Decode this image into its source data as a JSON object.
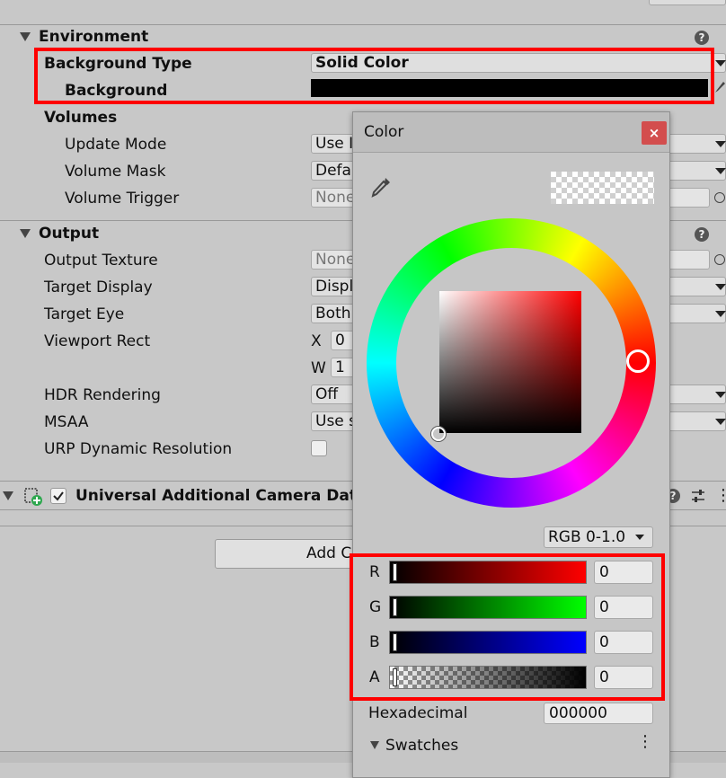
{
  "environment": {
    "header": "Environment",
    "background_type_label": "Background Type",
    "background_type_value": "Solid Color",
    "background_label": "Background",
    "background_color": "#000000"
  },
  "volumes": {
    "header": "Volumes",
    "update_mode_label": "Update Mode",
    "update_mode_value": "Use I",
    "volume_mask_label": "Volume Mask",
    "volume_mask_value": "Defau",
    "volume_trigger_label": "Volume Trigger",
    "volume_trigger_value": "None"
  },
  "output": {
    "header": "Output",
    "output_texture_label": "Output Texture",
    "output_texture_value": "None",
    "target_display_label": "Target Display",
    "target_display_value": "Displ",
    "target_eye_label": "Target Eye",
    "target_eye_value": "Both",
    "viewport_rect_label": "Viewport Rect",
    "viewport_x_label": "X",
    "viewport_x_value": "0",
    "viewport_w_label": "W",
    "viewport_w_value": "1",
    "hdr_label": "HDR Rendering",
    "hdr_value": "Off",
    "msaa_label": "MSAA",
    "msaa_value": "Use s",
    "urp_dynres_label": "URP Dynamic Resolution"
  },
  "component": {
    "name": "Universal Additional Camera Data (S"
  },
  "add_component_label": "Add C",
  "help_glyph": "?",
  "color_window": {
    "title": "Color",
    "close_glyph": "×",
    "mode_value": "RGB 0-1.0",
    "channels": [
      {
        "label": "R",
        "value": "0"
      },
      {
        "label": "G",
        "value": "0"
      },
      {
        "label": "B",
        "value": "0"
      },
      {
        "label": "A",
        "value": "0"
      }
    ],
    "hex_label": "Hexadecimal",
    "hex_value": "000000",
    "swatches_label": "Swatches",
    "more_glyph": "⋮"
  },
  "colors": {
    "highlight": "#ff0000",
    "panel_bg": "#c8c8c8"
  }
}
